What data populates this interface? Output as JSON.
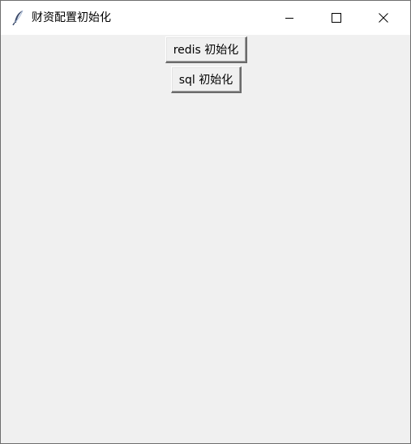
{
  "window": {
    "title": "财资配置初始化",
    "app_icon": "feather-icon",
    "controls": [
      "minimize-icon",
      "maximize-icon",
      "close-icon"
    ]
  },
  "buttons": {
    "redis_label": "redis 初始化",
    "sql_label": "sql 初始化"
  },
  "colors": {
    "titlebar_bg": "#ffffff",
    "window_bg": "#f0f0f0",
    "window_border": "#6e6e6e"
  }
}
